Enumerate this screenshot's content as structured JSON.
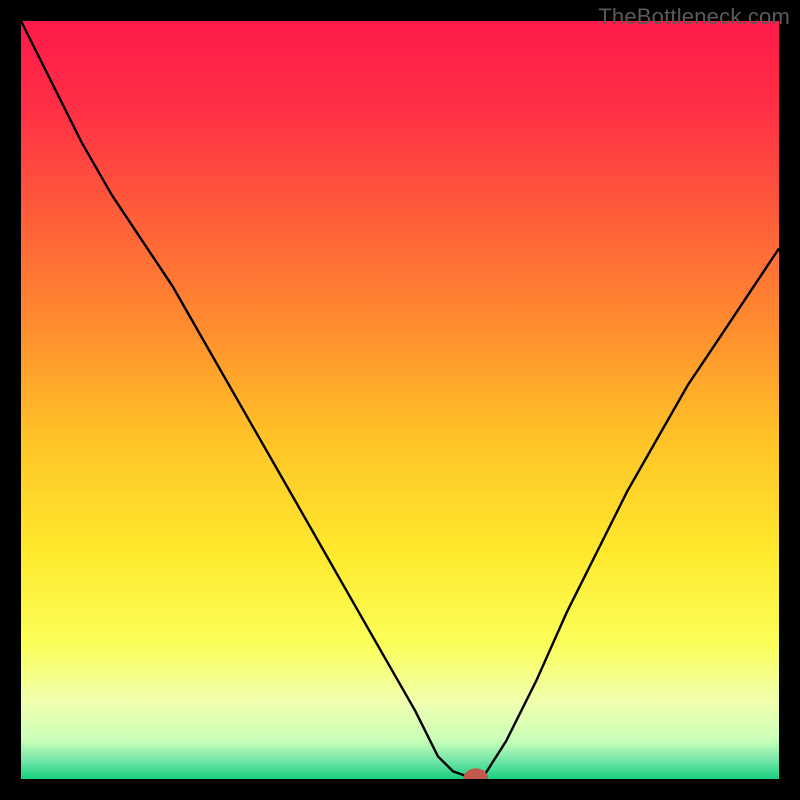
{
  "watermark": "TheBottleneck.com",
  "chart_data": {
    "type": "line",
    "title": "",
    "xlabel": "",
    "ylabel": "",
    "xlim": [
      0,
      100
    ],
    "ylim": [
      0,
      100
    ],
    "background": {
      "gradient_stops": [
        {
          "pos": 0.0,
          "color": "#ff1a4a"
        },
        {
          "pos": 0.12,
          "color": "#ff3045"
        },
        {
          "pos": 0.25,
          "color": "#ff5b3a"
        },
        {
          "pos": 0.4,
          "color": "#ff8b2f"
        },
        {
          "pos": 0.55,
          "color": "#ffc327"
        },
        {
          "pos": 0.7,
          "color": "#ffe92d"
        },
        {
          "pos": 0.82,
          "color": "#fbff58"
        },
        {
          "pos": 0.9,
          "color": "#f0ffb0"
        },
        {
          "pos": 0.95,
          "color": "#c8ffb8"
        },
        {
          "pos": 0.975,
          "color": "#74e6a8"
        },
        {
          "pos": 1.0,
          "color": "#18d080"
        }
      ]
    },
    "series": [
      {
        "name": "bottleneck-curve",
        "color": "#000000",
        "x": [
          0,
          4,
          8,
          12,
          16,
          20,
          24,
          28,
          32,
          36,
          40,
          44,
          48,
          52,
          55,
          57,
          59,
          61,
          64,
          68,
          72,
          76,
          80,
          84,
          88,
          92,
          96,
          100
        ],
        "values": [
          100,
          92,
          84,
          77,
          71,
          65,
          58,
          51,
          44,
          37,
          30,
          23,
          16,
          9,
          3,
          1,
          0.3,
          0.3,
          5,
          13,
          22,
          30,
          38,
          45,
          52,
          58,
          64,
          70
        ]
      }
    ],
    "marker": {
      "name": "optimal-point",
      "x": 60,
      "y": 0.2,
      "color": "#c15a4a",
      "rx": 1.6,
      "ry": 1.2
    }
  }
}
